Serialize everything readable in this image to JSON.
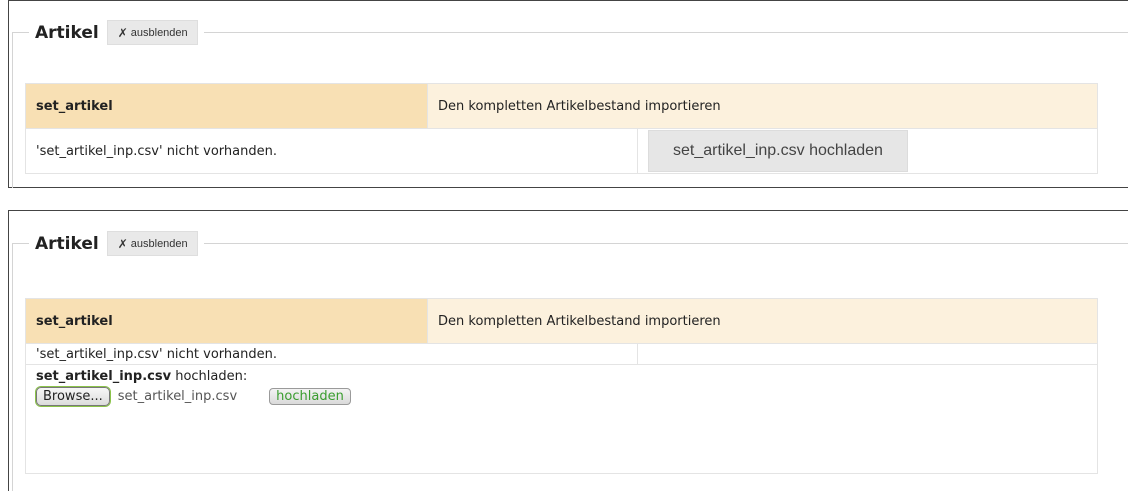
{
  "panels": [
    {
      "legend_title": "Artikel",
      "toggle_icon": "✗",
      "toggle_label": "ausblenden",
      "job_name": "set_artikel",
      "job_description": "Den kompletten Artikelbestand importieren",
      "status_text": "'set_artikel_inp.csv' nicht vorhanden.",
      "upload_button_label": "set_artikel_inp.csv hochladen"
    },
    {
      "legend_title": "Artikel",
      "toggle_icon": "✗",
      "toggle_label": "ausblenden",
      "job_name": "set_artikel",
      "job_description": "Den kompletten Artikelbestand importieren",
      "status_text": "'set_artikel_inp.csv' nicht vorhanden.",
      "upload_form": {
        "file_bold": "set_artikel_inp.csv",
        "label_suffix": " hochladen:",
        "browse_label": "Browse...",
        "selected_file": "set_artikel_inp.csv",
        "submit_label": "hochladen"
      }
    }
  ],
  "colors": {
    "header_name_bg": "#f8e0b4",
    "header_desc_bg": "#fcf1dd",
    "submit_text": "#3a9d2f"
  }
}
